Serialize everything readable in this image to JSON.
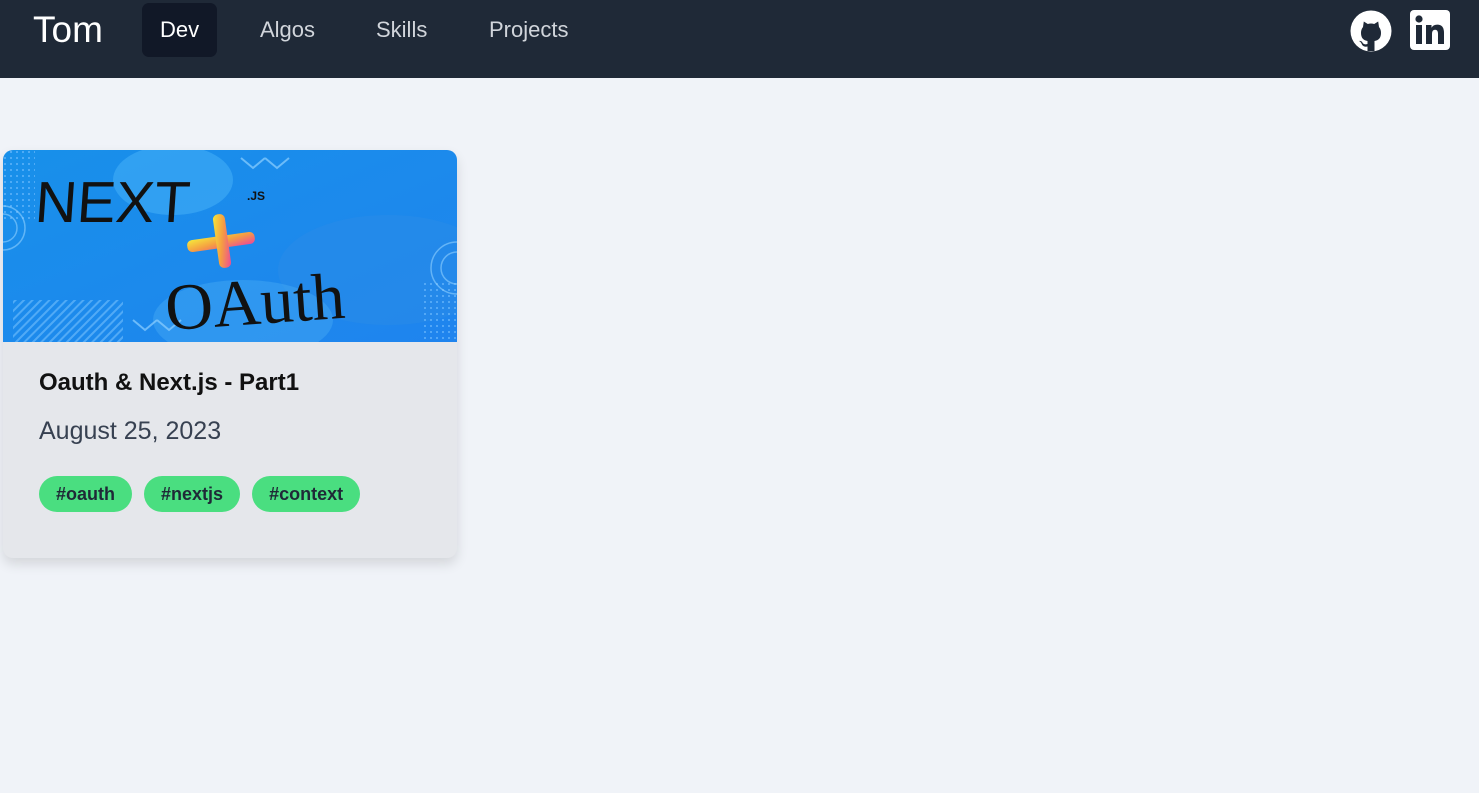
{
  "nav": {
    "brand": "Tom",
    "tabs": [
      {
        "label": "Dev",
        "active": true
      },
      {
        "label": "Algos",
        "active": false
      },
      {
        "label": "Skills",
        "active": false
      },
      {
        "label": "Projects",
        "active": false
      }
    ],
    "social_icons": [
      "github-icon",
      "linkedin-icon"
    ]
  },
  "posts": [
    {
      "title": "Oauth & Next.js - Part1",
      "date": "August 25, 2023",
      "tags": [
        "#oauth",
        "#nextjs",
        "#context"
      ],
      "hero": {
        "heading": "NEXT",
        "suffix": ".JS",
        "plus": "+",
        "subheading": "OAuth"
      }
    }
  ],
  "colors": {
    "nav_bg": "#1f2937",
    "active_tab_bg": "#111827",
    "page_bg": "#f0f3f8",
    "card_bg": "#e5e7eb",
    "tag_bg": "#4ade80",
    "hero_bg": "#1e90ee"
  }
}
